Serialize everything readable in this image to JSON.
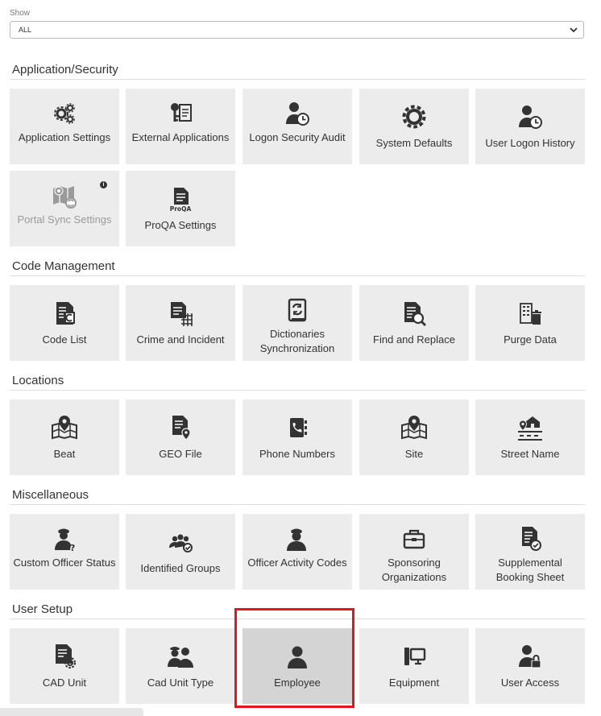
{
  "filter": {
    "label": "Show",
    "value": "ALL"
  },
  "sections": [
    {
      "title": "Application/Security",
      "tiles": [
        {
          "label": "Application Settings",
          "icon": "gears-icon"
        },
        {
          "label": "External Applications",
          "icon": "key-document-icon"
        },
        {
          "label": "Logon Security Audit",
          "icon": "user-clock-icon"
        },
        {
          "label": "System Defaults",
          "icon": "gear-icon"
        },
        {
          "label": "User Logon History",
          "icon": "user-clock-icon"
        },
        {
          "label": "Portal Sync Settings",
          "icon": "map-sync-icon",
          "disabled": true
        },
        {
          "label": "ProQA Settings",
          "icon": "proqa-document-icon",
          "badge": "ProQA"
        }
      ]
    },
    {
      "title": "Code Management",
      "tiles": [
        {
          "label": "Code List",
          "icon": "code-document-icon"
        },
        {
          "label": "Crime and Incident",
          "icon": "document-grid-icon"
        },
        {
          "label": "Dictionaries Synchronization",
          "icon": "book-sync-icon"
        },
        {
          "label": "Find and Replace",
          "icon": "document-search-icon"
        },
        {
          "label": "Purge Data",
          "icon": "building-trash-icon"
        }
      ]
    },
    {
      "title": "Locations",
      "tiles": [
        {
          "label": "Beat",
          "icon": "map-pin-icon"
        },
        {
          "label": "GEO File",
          "icon": "document-pin-icon"
        },
        {
          "label": "Phone Numbers",
          "icon": "address-book-icon"
        },
        {
          "label": "Site",
          "icon": "map-pin-icon"
        },
        {
          "label": "Street Name",
          "icon": "street-house-icon"
        }
      ]
    },
    {
      "title": "Miscellaneous",
      "tiles": [
        {
          "label": "Custom Officer Status",
          "icon": "officer-question-icon"
        },
        {
          "label": "Identified Groups",
          "icon": "group-check-icon"
        },
        {
          "label": "Officer Activity Codes",
          "icon": "officer-icon"
        },
        {
          "label": "Sponsoring Organizations",
          "icon": "briefcase-icon"
        },
        {
          "label": "Supplemental Booking Sheet",
          "icon": "document-check-icon"
        }
      ]
    },
    {
      "title": "User Setup",
      "tiles": [
        {
          "label": "CAD Unit",
          "icon": "document-gear-icon"
        },
        {
          "label": "Cad Unit Type",
          "icon": "officers-icon"
        },
        {
          "label": "Employee",
          "icon": "user-icon",
          "selected": true
        },
        {
          "label": "Equipment",
          "icon": "computer-icon"
        },
        {
          "label": "User Access",
          "icon": "user-lock-icon"
        }
      ]
    }
  ],
  "colors": {
    "tile_bg": "#ececec",
    "tile_selected": "#d4d4d4",
    "highlight": "#e8141b",
    "icon": "#333333"
  }
}
